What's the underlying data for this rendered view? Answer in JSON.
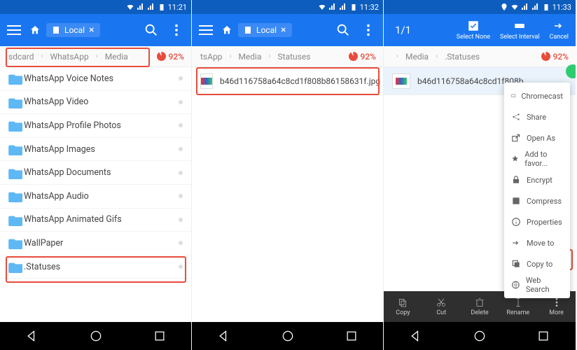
{
  "status_time": {
    "s1": "11:21",
    "s2": "11:32",
    "s3": "11:33"
  },
  "local_label": "Local",
  "counter": "1/1",
  "tb3": {
    "select_none": "Select None",
    "select_interval": "Select Interval",
    "cancel": "Cancel"
  },
  "breadcrumb": {
    "s1": [
      "sdcard",
      "WhatsApp",
      "Media"
    ],
    "s2": [
      "tsApp",
      "Media",
      "Statuses"
    ],
    "s3": [
      "",
      "Media",
      ".Statuses"
    ]
  },
  "storage_pct": "92%",
  "folders": [
    "WhatsApp Voice Notes",
    "WhatsApp Video",
    "WhatsApp Profile Photos",
    "WhatsApp Images",
    "WhatsApp Documents",
    "WhatsApp Audio",
    "WhatsApp Animated Gifs",
    "WallPaper",
    ".Statuses"
  ],
  "file_name": "b46d116758a64c8cd1f808b86158631f.jpg",
  "file_name_short": "b46d116758a64c8cd1f808b",
  "menu": {
    "chromecast": "Chromecast",
    "share": "Share",
    "open_as": "Open As",
    "fav": "Add to favor...",
    "encrypt": "Encrypt",
    "compress": "Compress",
    "properties": "Properties",
    "move": "Move to",
    "copy": "Copy to",
    "web": "Web Search"
  },
  "bottom": {
    "copy": "Copy",
    "cut": "Cut",
    "delete": "Delete",
    "rename": "Rename",
    "more": "More"
  }
}
